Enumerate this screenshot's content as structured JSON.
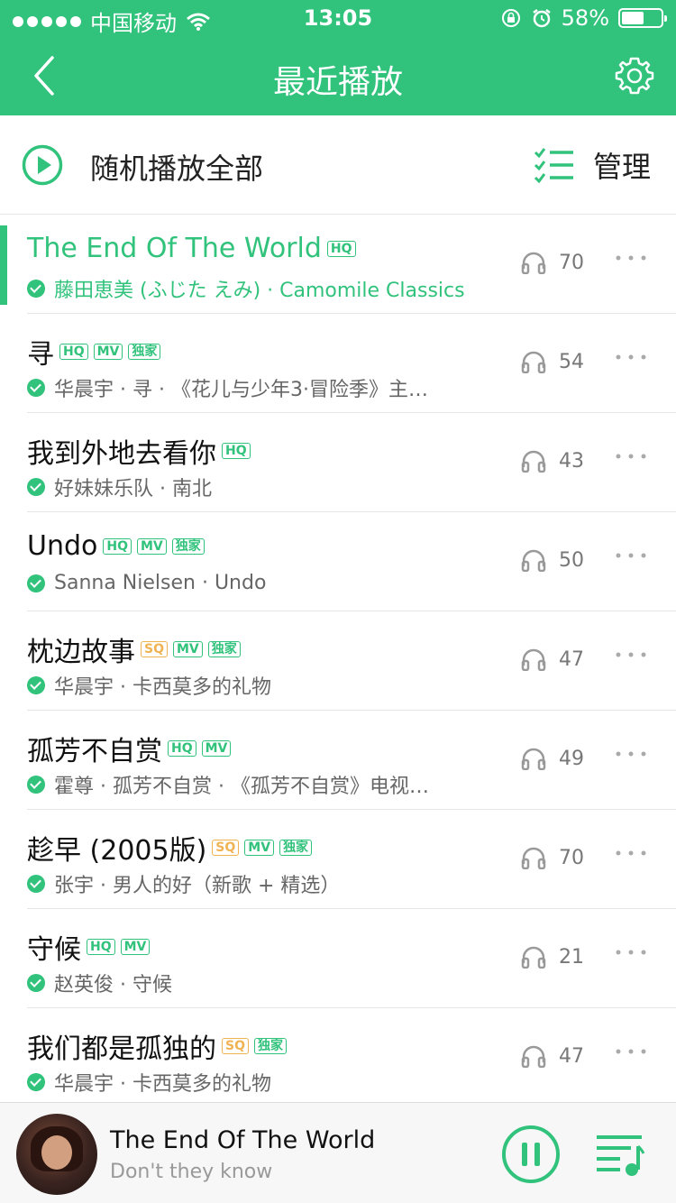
{
  "status": {
    "carrier": "中国移动",
    "time": "13:05",
    "battery_text": "58%",
    "battery_level": 0.58
  },
  "header": {
    "title": "最近播放"
  },
  "shuffle": {
    "label": "随机播放全部",
    "manage": "管理"
  },
  "songs": [
    {
      "title": "The End Of The World",
      "badges": [
        "HQ"
      ],
      "sub": "藤田恵美 (ふじた えみ) · Camomile Classics",
      "plays": "70",
      "active": true
    },
    {
      "title": "寻",
      "badges": [
        "HQ",
        "MV",
        "独家"
      ],
      "sub": "华晨宇 · 寻 · 《花儿与少年3·冒险季》主…",
      "plays": "54"
    },
    {
      "title": "我到外地去看你",
      "badges": [
        "HQ"
      ],
      "sub": "好妹妹乐队 · 南北",
      "plays": "43"
    },
    {
      "title": "Undo",
      "badges": [
        "HQ",
        "MV",
        "独家"
      ],
      "sub": "Sanna Nielsen · Undo",
      "plays": "50"
    },
    {
      "title": "枕边故事",
      "badges": [
        "SQ",
        "MV",
        "独家"
      ],
      "sub": "华晨宇 · 卡西莫多的礼物",
      "plays": "47"
    },
    {
      "title": "孤芳不自赏",
      "badges": [
        "HQ",
        "MV"
      ],
      "sub": "霍尊 · 孤芳不自赏 · 《孤芳不自赏》电视…",
      "plays": "49"
    },
    {
      "title": "趁早 (2005版)",
      "badges": [
        "SQ",
        "MV",
        "独家"
      ],
      "sub": "张宇 · 男人的好（新歌 + 精选）",
      "plays": "70"
    },
    {
      "title": "守候",
      "badges": [
        "HQ",
        "MV"
      ],
      "sub": "赵英俊 · 守候",
      "plays": "21"
    },
    {
      "title": "我们都是孤独的",
      "badges": [
        "SQ",
        "独家"
      ],
      "sub": "华晨宇 · 卡西莫多的礼物",
      "plays": "47"
    }
  ],
  "player": {
    "track": "The End Of The World",
    "artist": "Don't they know"
  },
  "colors": {
    "accent": "#31c27c",
    "sq": "#f0b354"
  }
}
